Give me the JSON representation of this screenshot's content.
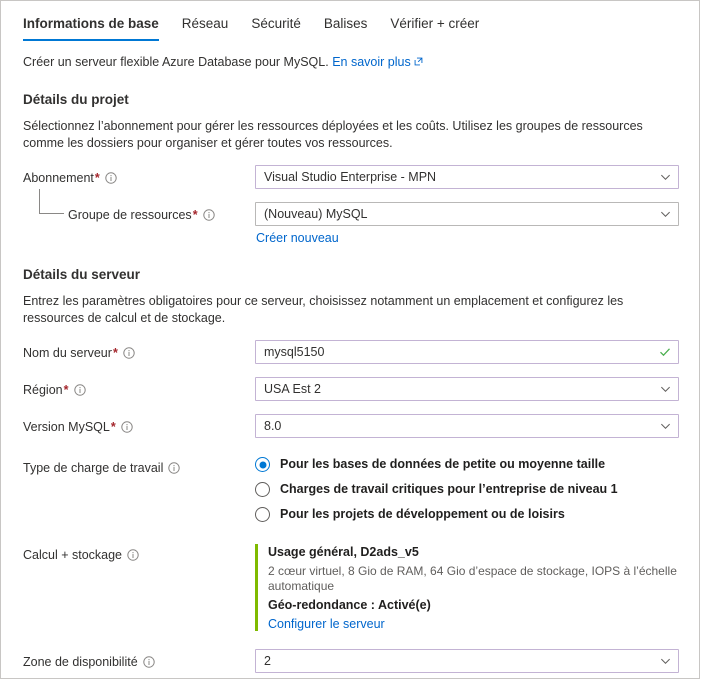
{
  "tabs": [
    {
      "label": "Informations de base",
      "active": true
    },
    {
      "label": "Réseau",
      "active": false
    },
    {
      "label": "Sécurité",
      "active": false
    },
    {
      "label": "Balises",
      "active": false
    },
    {
      "label": "Vérifier + créer",
      "active": false
    }
  ],
  "intro": {
    "text": "Créer un serveur flexible Azure Database pour MySQL.",
    "link_label": "En savoir plus",
    "link_icon": "external-link-icon"
  },
  "project_details": {
    "title": "Détails du projet",
    "description": "Sélectionnez l’abonnement pour gérer les ressources déployées et les coûts. Utilisez les groupes de ressources comme les dossiers pour organiser et gérer toutes vos ressources.",
    "subscription": {
      "label": "Abonnement",
      "required": "*",
      "info_icon": "info-icon",
      "value": "Visual Studio Enterprise - MPN",
      "chevron_icon": "chevron-down-icon"
    },
    "resource_group": {
      "label": "Groupe de ressources",
      "required": "*",
      "info_icon": "info-icon",
      "value": "(Nouveau) MySQL",
      "chevron_icon": "chevron-down-icon",
      "create_new_label": "Créer nouveau"
    }
  },
  "server_details": {
    "title": "Détails du serveur",
    "description": "Entrez les paramètres obligatoires pour ce serveur, choisissez notamment un emplacement et configurez les ressources de calcul et de stockage.",
    "server_name": {
      "label": "Nom du serveur",
      "required": "*",
      "info_icon": "info-icon",
      "value": "mysql5150",
      "valid_icon": "green-check-icon"
    },
    "region": {
      "label": "Région",
      "required": "*",
      "info_icon": "info-icon",
      "value": "USA Est 2",
      "chevron_icon": "chevron-down-icon"
    },
    "mysql_version": {
      "label": "Version MySQL",
      "required": "*",
      "info_icon": "info-icon",
      "value": "8.0",
      "chevron_icon": "chevron-down-icon"
    },
    "workload_type": {
      "label": "Type de charge de travail",
      "info_icon": "info-icon",
      "options": [
        {
          "label": "Pour les bases de données de petite ou moyenne taille",
          "selected": true
        },
        {
          "label": "Charges de travail critiques pour l’entreprise de niveau 1",
          "selected": false
        },
        {
          "label": "Pour les projets de développement ou de loisirs",
          "selected": false
        }
      ]
    },
    "compute_storage": {
      "label": "Calcul + stockage",
      "info_icon": "info-icon",
      "tier": "Usage général, D2ads_v5",
      "specs": "2 cœur virtuel, 8 Gio de RAM, 64 Gio d’espace de stockage, IOPS à l’échelle automatique",
      "geo_redundancy": "Géo-redondance : Activé(e)",
      "configure_link": "Configurer le serveur"
    },
    "availability_zone": {
      "label": "Zone de disponibilité",
      "info_icon": "info-icon",
      "value": "2",
      "chevron_icon": "chevron-down-icon"
    }
  },
  "colors": {
    "accent_blue": "#0078d4",
    "link_blue": "#0066cc",
    "required_red": "#a4262c",
    "focus_purple": "#c3b3d4",
    "valid_green": "#107c10",
    "compute_green": "#7fba00"
  }
}
